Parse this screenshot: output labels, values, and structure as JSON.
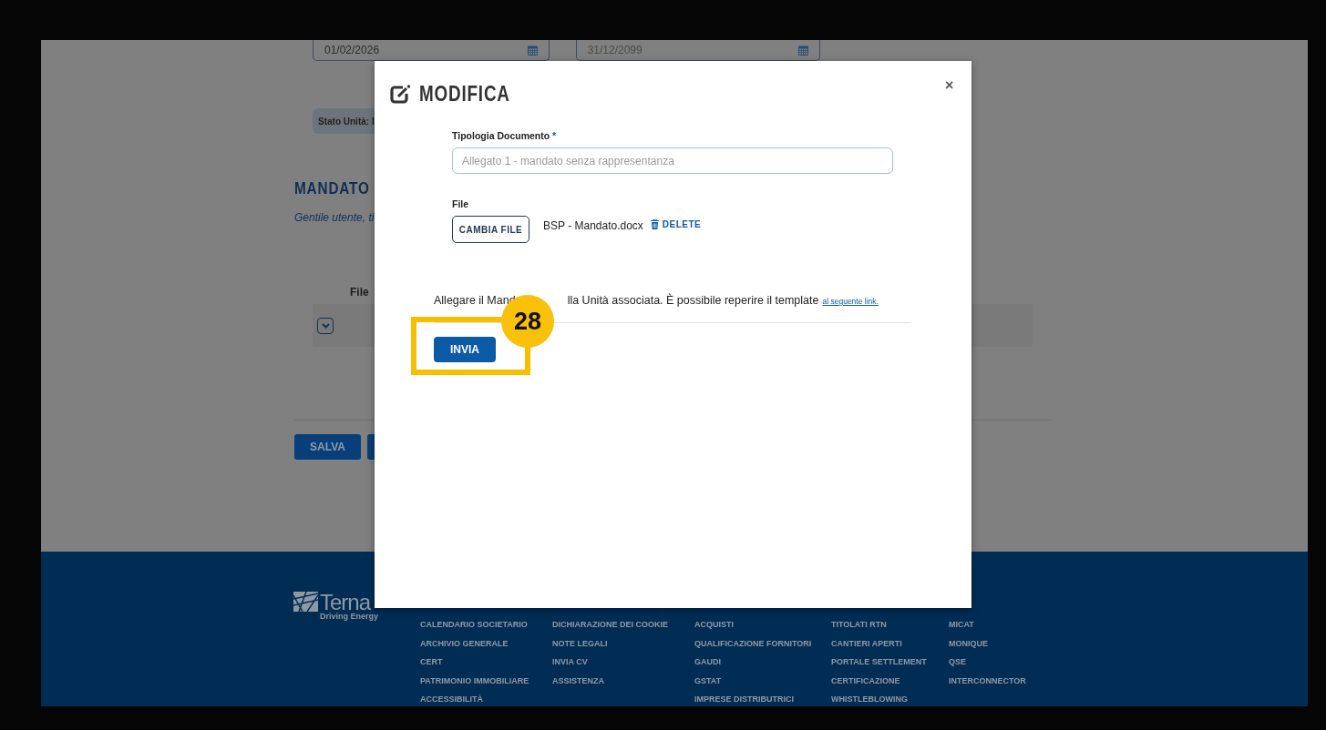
{
  "background_form": {
    "date_from": "01/02/2026",
    "date_to": "31/12/2099",
    "status_label": "Stato Unità: I",
    "section_title": "MANDATO",
    "intro_text": "Gentile utente, ti",
    "table": {
      "columns": [
        "File"
      ]
    },
    "buttons": [
      "SALVA"
    ]
  },
  "footer": {
    "logo": {
      "name": "Terna",
      "tagline": "Driving Energy"
    },
    "link_columns": [
      [
        "CALENDARIO SOCIETARIO",
        "ARCHIVIO GENERALE",
        "CERT",
        "PATRIMONIO IMMOBILIARE",
        "ACCESSIBILITÀ"
      ],
      [
        "DICHIARAZIONE DEI COOKIE",
        "NOTE LEGALI",
        "INVIA CV",
        "ASSISTENZA"
      ],
      [
        "ACQUISTI",
        "QUALIFICAZIONE FORNITORI",
        "GAUDI",
        "GSTAT",
        "IMPRESE DISTRIBUTRICI"
      ],
      [
        "TITOLATI RTN",
        "CANTIERI APERTI",
        "PORTALE SETTLEMENT",
        "CERTIFICAZIONE",
        "WHISTLEBLOWING"
      ],
      [
        "MICAT",
        "MONIQUE",
        "QSE",
        "INTERCONNECTOR"
      ]
    ]
  },
  "dialog": {
    "title": "MODIFICA",
    "close": "×",
    "document_type": {
      "label": "Tipologia Documento",
      "required_mark": "*",
      "placeholder": "Allegato 1 - mandato senza rappresentanza"
    },
    "file": {
      "label": "File",
      "change_button": "CAMBIA FILE",
      "file_name": "BSP - Mandato.docx",
      "delete": "DELETE"
    },
    "note": {
      "text_before": "Allegare il Mand",
      "text_after": "lla Unità associata. È possibile reperire il template",
      "link": "al seguente link."
    },
    "submit": "INVIA"
  },
  "annotation": {
    "number": "28"
  }
}
